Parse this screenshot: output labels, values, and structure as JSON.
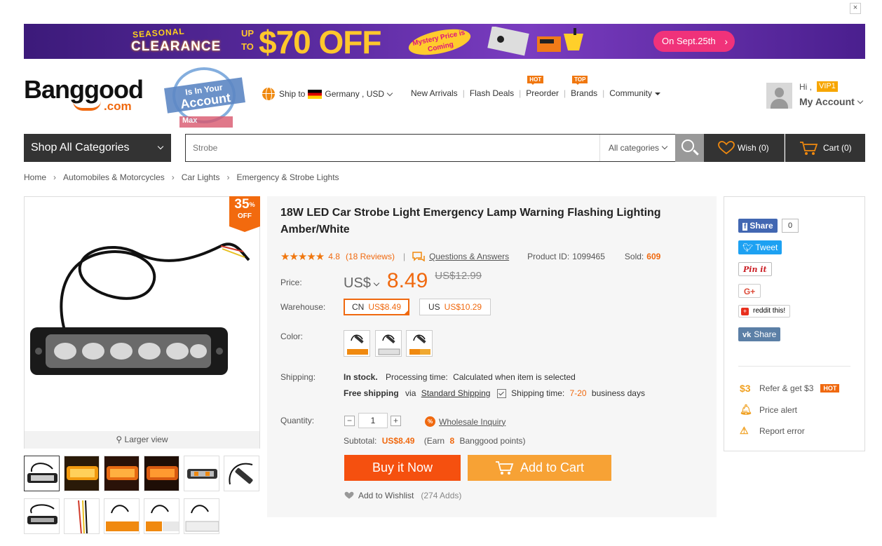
{
  "close_label": "×",
  "banner": {
    "seasonal": "SEASONAL",
    "clearance": "CLEARANCE",
    "up": "UP",
    "to": "TO",
    "off": "$70 OFF",
    "mystery": "Mystery Price is Coming",
    "date_button": "On Sept.25th"
  },
  "logo": {
    "brand": "Banggood",
    "domain": ".com"
  },
  "stamp": {
    "line1": "Is In Your",
    "line2": "Account",
    "line3": "Max"
  },
  "header": {
    "ship_to_label": "Ship to",
    "ship_to_value": "Germany , USD",
    "nav": [
      {
        "label": "New Arrivals",
        "tag": ""
      },
      {
        "label": "Flash Deals",
        "tag": ""
      },
      {
        "label": "Preorder",
        "tag": "HOT"
      },
      {
        "label": "Brands",
        "tag": "TOP"
      },
      {
        "label": "Community",
        "tag": ""
      }
    ],
    "greeting": "Hi ,",
    "vip": "VIP1",
    "my_account": "My Account"
  },
  "search": {
    "categories_button": "Shop All Categories",
    "placeholder": "Strobe",
    "category_select": "All categories",
    "wish": "Wish (0)",
    "cart": "Cart (0)"
  },
  "breadcrumb": [
    "Home",
    "Automobiles & Motorcycles",
    "Car Lights",
    "Emergency & Strobe Lights"
  ],
  "gallery": {
    "discount_pct": "35",
    "discount_sign": "%",
    "discount_off": "OFF",
    "larger_view": "Larger view"
  },
  "product": {
    "title": "18W LED Car Strobe Light Emergency Lamp Warning Flashing Lighting Amber/White",
    "rating_stars": 5,
    "rating_value": "4.8",
    "reviews": "(18 Reviews)",
    "qa": "Questions & Answers",
    "product_id_label": "Product ID:",
    "product_id": "1099465",
    "sold_label": "Sold:",
    "sold": "609",
    "price_label": "Price:",
    "currency": "US$",
    "price": "8.49",
    "old_price": "US$12.99",
    "warehouse_label": "Warehouse:",
    "warehouses": [
      {
        "code": "CN",
        "price": "US$8.49"
      },
      {
        "code": "US",
        "price": "US$10.29"
      }
    ],
    "color_label": "Color:",
    "shipping_label": "Shipping:",
    "in_stock": "In stock.",
    "processing_label": "Processing time:",
    "processing_value": "Calculated when item is selected",
    "free_shipping": "Free shipping",
    "via": "via",
    "shipping_method": "Standard Shipping",
    "shipping_time_label": "Shipping time:",
    "shipping_time_value": "7-20",
    "shipping_time_unit": "business days",
    "quantity_label": "Quantity:",
    "quantity": "1",
    "minus": "−",
    "plus": "+",
    "wholesale": "Wholesale Inquiry",
    "subtotal_label": "Subtotal:",
    "subtotal": "US$8.49",
    "earn_prefix": "(Earn",
    "earn_points": "8",
    "earn_suffix": "Banggood points)",
    "buy_now": "Buy it Now",
    "add_to_cart": "Add to Cart",
    "add_to_wishlist": "Add to Wishlist",
    "wishlist_adds": "(274 Adds)"
  },
  "social": {
    "fb": "Share",
    "fb_count": "0",
    "tweet": "Tweet",
    "pinit": "Pin it",
    "gplus": "G+",
    "reddit": "reddit this!",
    "vk": "Share",
    "refer": "Refer & get $3",
    "refer_icon": "$3",
    "hot": "HOT",
    "price_alert": "Price alert",
    "report_error": "Report error"
  }
}
